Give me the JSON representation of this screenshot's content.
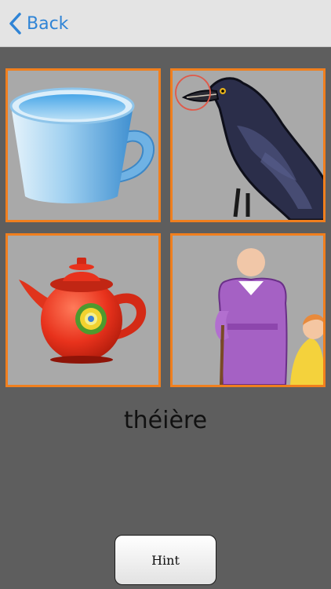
{
  "navbar": {
    "back_label": "Back",
    "back_icon": "chevron-left-icon",
    "accent": "#2f84d6"
  },
  "tiles": [
    {
      "item": "cup"
    },
    {
      "item": "crow"
    },
    {
      "item": "teapot"
    },
    {
      "item": "grandmother"
    }
  ],
  "prompt_word": "théière",
  "hint_label": "Hint",
  "colors": {
    "tile_border": "#f07f1e",
    "background": "#5e5e5e"
  }
}
